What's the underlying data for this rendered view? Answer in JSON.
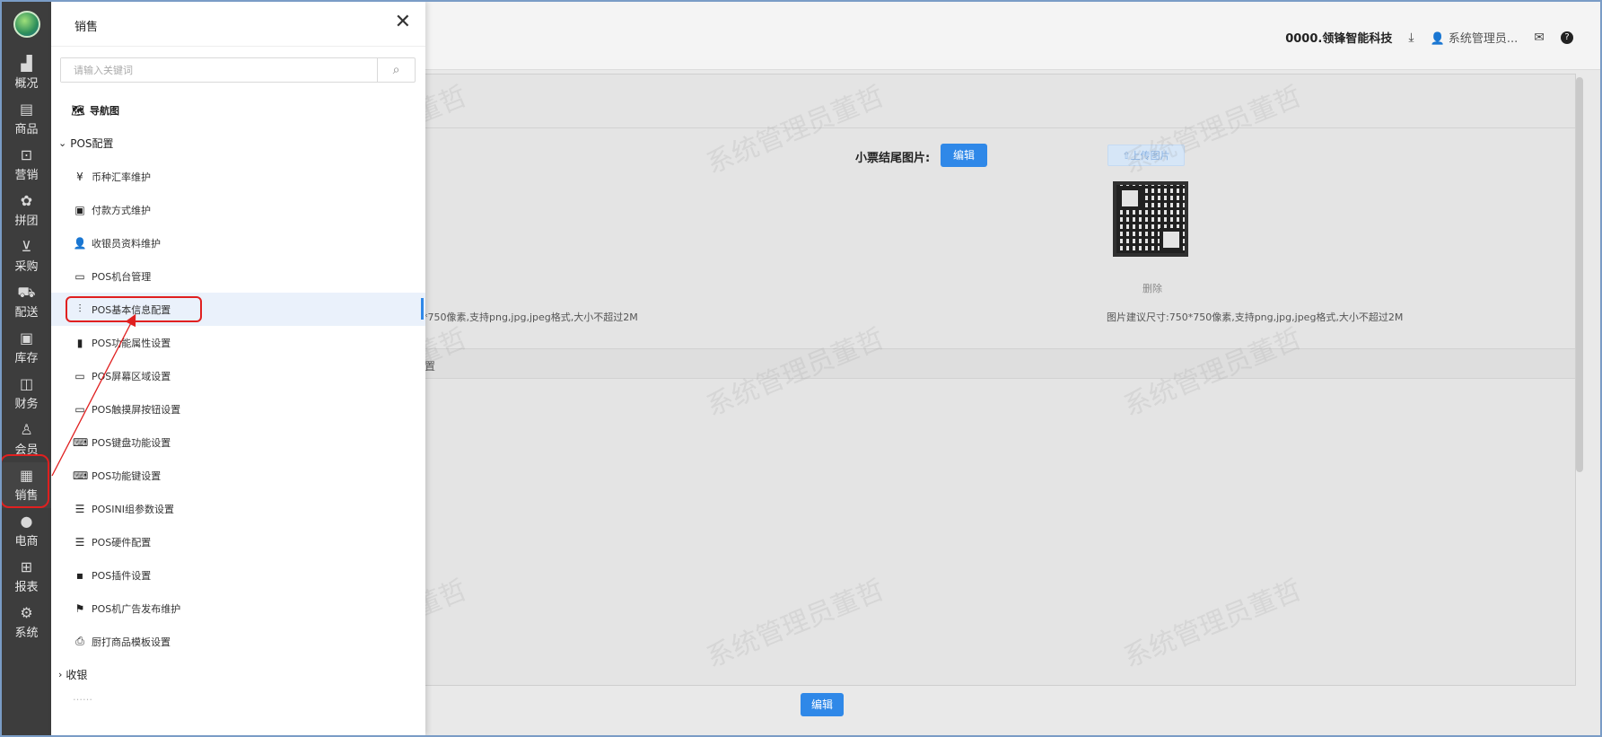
{
  "header": {
    "company": "0000.领锋智能科技",
    "user": "系统管理员..."
  },
  "nav": [
    {
      "label": "概况",
      "icon": "chart-icon"
    },
    {
      "label": "商品",
      "icon": "document-icon"
    },
    {
      "label": "营销",
      "icon": "bag-icon"
    },
    {
      "label": "拼团",
      "icon": "group-icon"
    },
    {
      "label": "采购",
      "icon": "cart-icon"
    },
    {
      "label": "配送",
      "icon": "truck-icon"
    },
    {
      "label": "库存",
      "icon": "box-icon"
    },
    {
      "label": "财务",
      "icon": "finance-icon"
    },
    {
      "label": "会员",
      "icon": "person-icon"
    },
    {
      "label": "销售",
      "icon": "register-icon"
    },
    {
      "label": "电商",
      "icon": "user-icon"
    },
    {
      "label": "报表",
      "icon": "board-icon"
    },
    {
      "label": "系统",
      "icon": "gear-icon"
    }
  ],
  "panel": {
    "title": "销售",
    "search_placeholder": "请输入关键词",
    "nav_map": "导航图",
    "group_pos": "POS配置",
    "items": [
      "币种汇率维护",
      "付款方式维护",
      "收银员资料维护",
      "POS机台管理",
      "POS基本信息配置",
      "POS功能属性设置",
      "POS屏幕区域设置",
      "POS触摸屏按钮设置",
      "POS键盘功能设置",
      "POS功能键设置",
      "POSINI组参数设置",
      "POS硬件配置",
      "POS插件设置",
      "POS机广告发布维护",
      "厨打商品模板设置"
    ],
    "group_cashier": "收银",
    "faded_row": "……"
  },
  "content": {
    "receipt_tail_label": "小票结尾图片:",
    "edit_label": "编辑",
    "upload_label": "⇧上传图片",
    "delete_label": "删除",
    "hint_left": "*750像素,支持png,jpg,jpeg格式,大小不超过2M",
    "hint_right": "图片建议尺寸:750*750像素,支持png,jpg,jpeg格式,大小不超过2M",
    "band_text": "置",
    "bottom_edit_label": "编辑"
  },
  "watermark_text": "系统管理员董哲"
}
